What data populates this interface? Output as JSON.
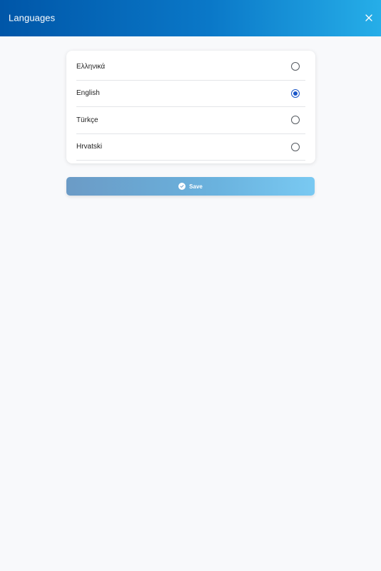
{
  "header": {
    "title": "Languages",
    "close_icon": "close-icon"
  },
  "languages": {
    "options": [
      {
        "label": "Ελληνικά",
        "selected": false
      },
      {
        "label": "English",
        "selected": true
      },
      {
        "label": "Türkçe",
        "selected": false
      },
      {
        "label": "Hrvatski",
        "selected": false
      }
    ],
    "selected_value": "English"
  },
  "save_button": {
    "label": "Save",
    "icon": "check-circle-icon"
  },
  "colors": {
    "header_gradient_start": "#0056a8",
    "header_gradient_end": "#26aee8",
    "radio_selected": "#1a56c8",
    "save_gradient_start": "#6b9bc6",
    "save_gradient_end": "#79c9f2",
    "background": "#f8f9fb"
  }
}
